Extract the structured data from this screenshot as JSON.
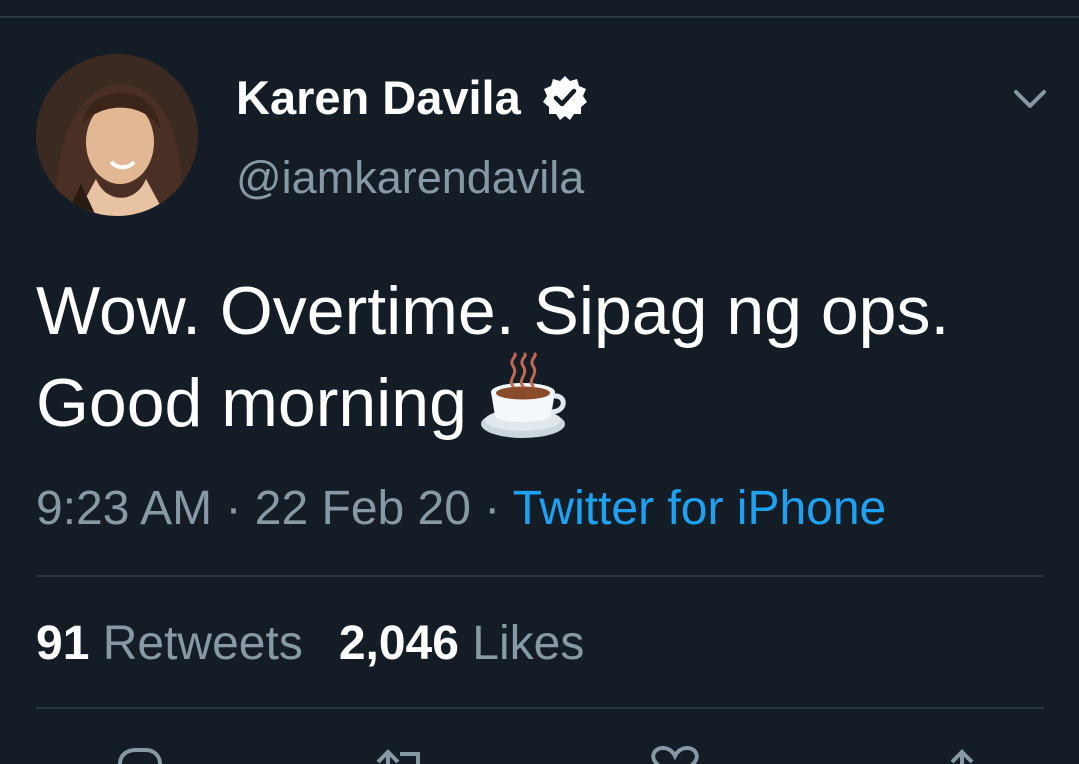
{
  "user": {
    "display_name": "Karen Davila",
    "handle": "@iamkarendavila",
    "verified": true
  },
  "tweet": {
    "text_line1": "Wow. Overtime. Sipag ng ops.",
    "text_line2": "Good morning",
    "emoji": "hot-beverage"
  },
  "meta": {
    "time": "9:23 AM",
    "separator": " · ",
    "date": "22 Feb 20",
    "source": "Twitter for iPhone"
  },
  "stats": {
    "retweets_count": "91",
    "retweets_label": "Retweets",
    "likes_count": "2,046",
    "likes_label": "Likes"
  },
  "colors": {
    "background": "#141d26",
    "secondary_text": "#8899a6",
    "link": "#1da1f2",
    "divider": "#2b3743"
  },
  "actions": [
    "reply-icon",
    "retweet-icon",
    "like-icon",
    "share-icon"
  ]
}
